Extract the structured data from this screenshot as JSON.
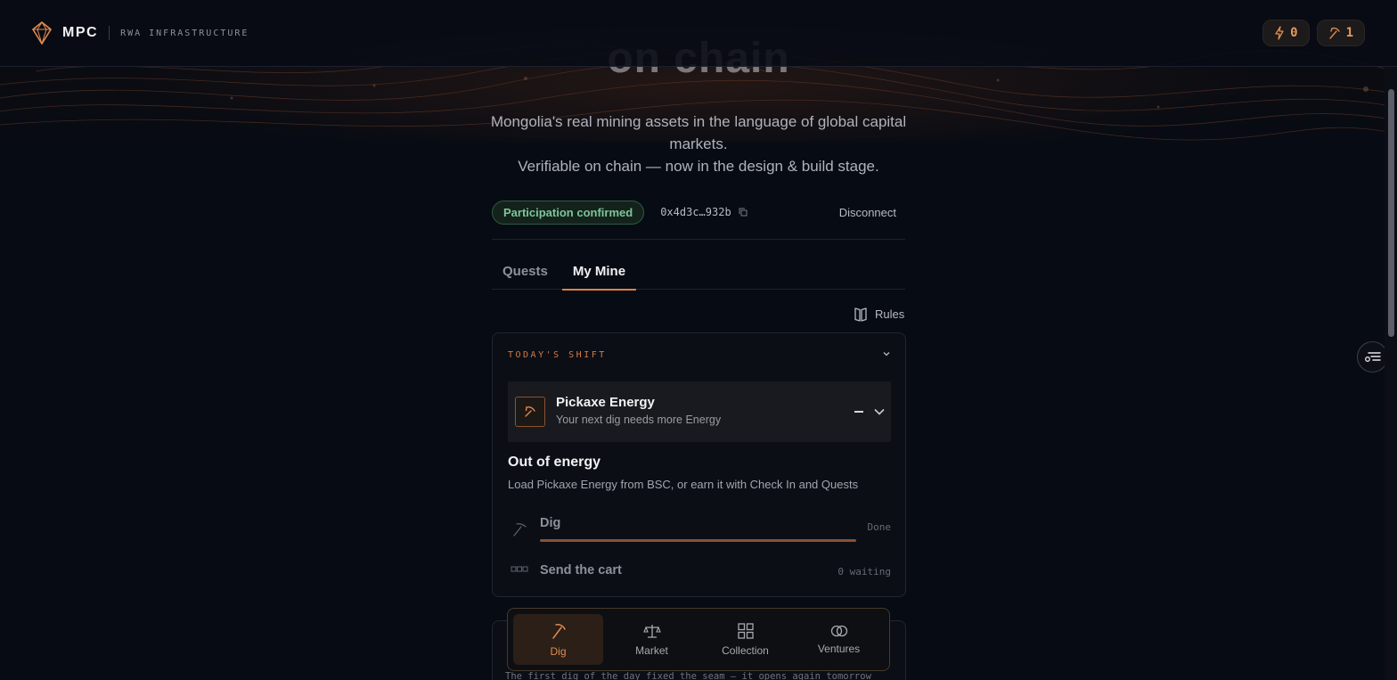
{
  "brand": {
    "name": "MPC",
    "tagline": "RWA INFRASTRUCTURE"
  },
  "header": {
    "energy_count": "0",
    "pickaxe_count": "1"
  },
  "hero": {
    "heading_fragment": "on chain",
    "subtitle_line1": "Mongolia's real mining assets in the language of global capital markets.",
    "subtitle_line2": "Verifiable on chain — now in the design & build stage."
  },
  "account": {
    "status_badge": "Participation confirmed",
    "address": "0x4d3c…932b",
    "disconnect_label": "Disconnect"
  },
  "tabs": [
    {
      "label": "Quests",
      "active": false
    },
    {
      "label": "My Mine",
      "active": true
    }
  ],
  "rules_label": "Rules",
  "shift": {
    "title": "TODAY'S SHIFT",
    "energy": {
      "title": "Pickaxe Energy",
      "subtitle": "Your next dig needs more Energy"
    },
    "out_of_energy": {
      "title": "Out of energy",
      "subtitle": "Load Pickaxe Energy from BSC, or earn it with Check In and Quests"
    },
    "dig": {
      "label": "Dig",
      "status": "Done",
      "progress": 1.0
    },
    "cart": {
      "label": "Send the cart",
      "status": "0 waiting"
    }
  },
  "next_card_text": "The first dig of the day fixed the seam — it opens again tomorrow",
  "bottom_nav": [
    {
      "label": "Dig",
      "icon": "pickaxe-icon",
      "active": true
    },
    {
      "label": "Market",
      "icon": "scale-icon",
      "active": false
    },
    {
      "label": "Collection",
      "icon": "grid-icon",
      "active": false
    },
    {
      "label": "Ventures",
      "icon": "rings-icon",
      "active": false
    }
  ],
  "colors": {
    "accent": "#e07f45",
    "background": "#070b13",
    "success": "#7fc49a"
  }
}
